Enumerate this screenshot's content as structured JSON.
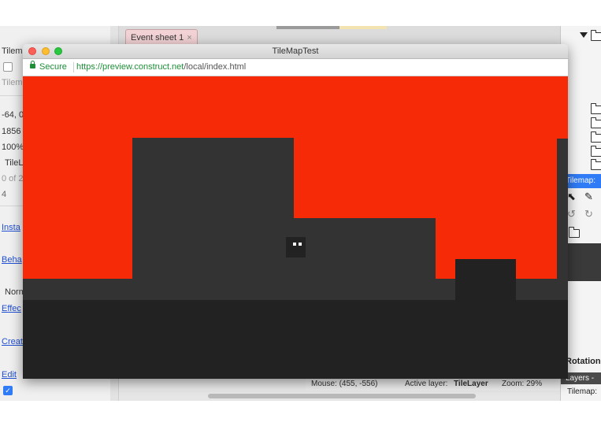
{
  "editor": {
    "left_panel": {
      "rows": [
        "Tilem",
        "Tilem",
        "-64, 0",
        "1856",
        "100%",
        "TileL",
        "0 of 2",
        "4",
        "Insta",
        "Beha",
        "Norm",
        "Effec",
        "Creat",
        "Edit"
      ]
    },
    "tab": {
      "label": "Event sheet 1",
      "close": "×"
    },
    "status": {
      "mouse": "Mouse: (455, -556)",
      "active_layer_prefix": "Active layer:",
      "active_layer": "TileLayer",
      "zoom": "Zoom: 29%"
    },
    "right_panel": {
      "tilemap_header": "Tilemap:",
      "rotation": "Rotation",
      "layers_tab": "Layers -",
      "tilemap_label": "Tilemap:"
    }
  },
  "preview": {
    "window_title": "TileMapTest",
    "secure_label": "Secure",
    "url_origin": "https://preview.construct.net",
    "url_path": "/local/index.html",
    "colors": {
      "sky": "#f62a06",
      "terrain": "#333333",
      "ground": "#222222",
      "player_eyes": "#ffffff"
    }
  },
  "icons": [
    "lock-icon",
    "folder-icon",
    "triangle-down-icon",
    "pointer-icon",
    "pencil-icon",
    "undo-icon",
    "redo-icon",
    "close-icon",
    "checkmark-icon"
  ]
}
